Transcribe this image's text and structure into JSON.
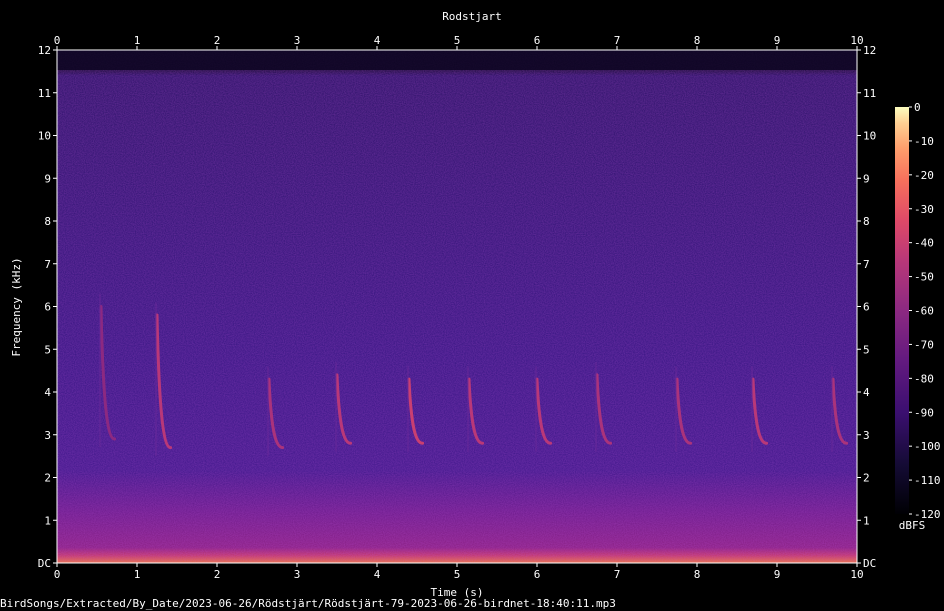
{
  "chart_data": {
    "type": "heatmap",
    "title": "Rodstjart",
    "xlabel": "Time (s)",
    "ylabel": "Frequency (kHz)",
    "xlim": [
      0,
      10
    ],
    "ylim": [
      0,
      12
    ],
    "x_ticks": [
      "0",
      "1",
      "2",
      "3",
      "4",
      "5",
      "6",
      "7",
      "8",
      "9",
      "10"
    ],
    "y_ticks": [
      "DC",
      "1",
      "2",
      "3",
      "4",
      "5",
      "6",
      "7",
      "8",
      "9",
      "10",
      "11",
      "12"
    ],
    "colorbar": {
      "label": "dBFS",
      "ticks": [
        "0",
        "-10",
        "-20",
        "-30",
        "-40",
        "-50",
        "-60",
        "-70",
        "-80",
        "-90",
        "-100",
        "-110",
        "-120"
      ],
      "range": [
        -120,
        0
      ],
      "colormap": "inferno"
    },
    "calls": [
      {
        "t": 0.55,
        "f_start": 6.0,
        "f_end": 2.9,
        "level": -60
      },
      {
        "t": 1.25,
        "f_start": 5.8,
        "f_end": 2.7,
        "level": -45
      },
      {
        "t": 2.65,
        "f_start": 4.3,
        "f_end": 2.7,
        "level": -50
      },
      {
        "t": 3.5,
        "f_start": 4.4,
        "f_end": 2.8,
        "level": -45
      },
      {
        "t": 4.4,
        "f_start": 4.3,
        "f_end": 2.8,
        "level": -40
      },
      {
        "t": 5.15,
        "f_start": 4.3,
        "f_end": 2.8,
        "level": -45
      },
      {
        "t": 6.0,
        "f_start": 4.3,
        "f_end": 2.8,
        "level": -45
      },
      {
        "t": 6.75,
        "f_start": 4.4,
        "f_end": 2.8,
        "level": -50
      },
      {
        "t": 7.75,
        "f_start": 4.3,
        "f_end": 2.8,
        "level": -50
      },
      {
        "t": 8.7,
        "f_start": 4.3,
        "f_end": 2.8,
        "level": -45
      },
      {
        "t": 9.7,
        "f_start": 4.3,
        "f_end": 2.8,
        "level": -50
      }
    ]
  },
  "footer": {
    "filename": "BirdSongs/Extracted/By_Date/2023-06-26/Rödstjärt/Rödstjärt-79-2023-06-26-birdnet-18:40:11.mp3"
  },
  "colors": {
    "background": "#000000",
    "text": "#ffffff"
  }
}
